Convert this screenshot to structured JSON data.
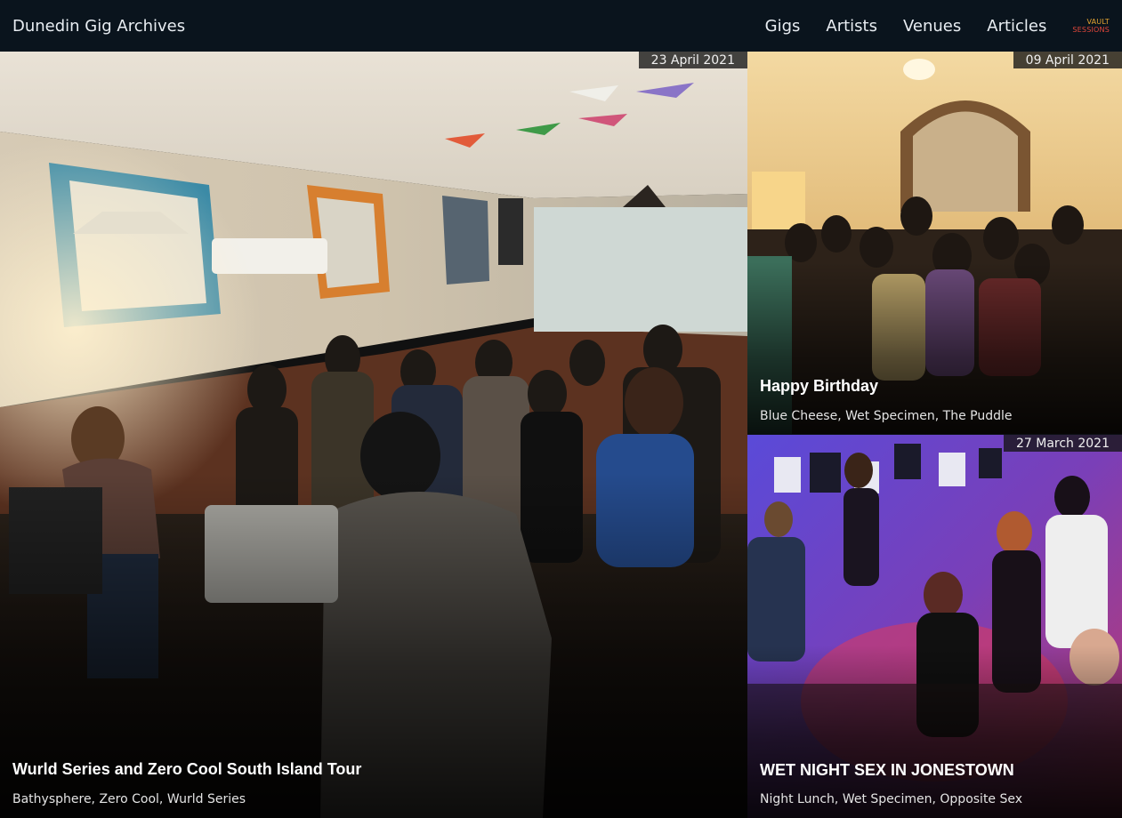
{
  "header": {
    "brand": "Dunedin Gig Archives",
    "nav": [
      "Gigs",
      "Artists",
      "Venues",
      "Articles"
    ],
    "vault_logo": {
      "line1": "VAULT",
      "line2": "SESSIONS"
    }
  },
  "gigs": [
    {
      "date": "23 April 2021",
      "title": "Wurld Series and Zero Cool South Island Tour",
      "bands": "Bathysphere, Zero Cool, Wurld Series"
    },
    {
      "date": "09 April 2021",
      "title": "Happy Birthday",
      "bands": "Blue Cheese, Wet Specimen, The Puddle"
    },
    {
      "date": "27 March 2021",
      "title": "WET NIGHT SEX IN JONESTOWN",
      "bands": "Night Lunch, Wet Specimen, Opposite Sex"
    }
  ],
  "colors": {
    "header_bg": "#0a141d",
    "vault_orange": "#e6a531",
    "vault_red": "#e2473b"
  }
}
